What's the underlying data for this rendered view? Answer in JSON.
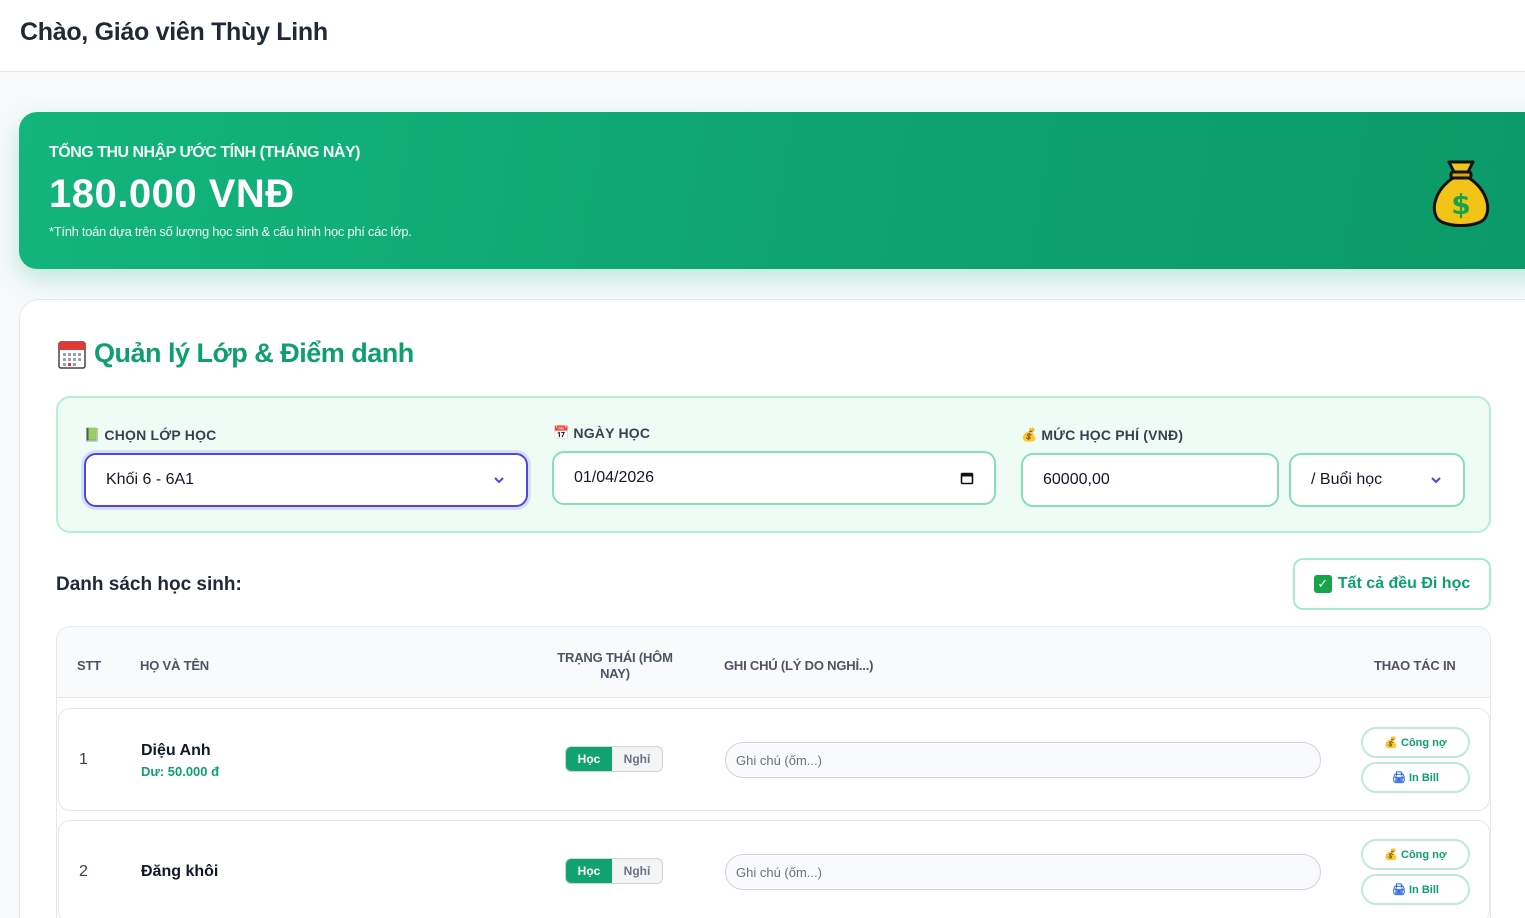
{
  "header": {
    "greeting": "Chào, Giáo viên Thùy Linh"
  },
  "income": {
    "label": "TỔNG THU NHẬP ƯỚC TÍNH (THÁNG NÀY)",
    "amount": "180.000 VNĐ",
    "note": "*Tính toán dựa trên số lượng học sinh & cấu hình học phí các lớp.",
    "icon": "money-bag-icon"
  },
  "section": {
    "title": "Quản lý Lớp & Điểm danh",
    "icon": "calendar-icon"
  },
  "filters": {
    "class_label": "CHỌN LỚP HỌC",
    "class_value": "Khối 6 - 6A1",
    "date_label": "NGÀY HỌC",
    "date_value": "01/04/2026",
    "fee_label": "MỨC HỌC PHÍ (VNĐ)",
    "fee_value": "60000,00",
    "unit_value": "/ Buổi học"
  },
  "list": {
    "title": "Danh sách học sinh:",
    "all_present_label": "Tất cả đều Đi học"
  },
  "table": {
    "columns": [
      "STT",
      "HỌ VÀ TÊN",
      "TRẠNG THÁI (HÔM NAY)",
      "GHI CHÚ (LÝ DO NGHỈ...)",
      "THAO TÁC IN"
    ],
    "rows": [
      {
        "stt": "1",
        "name": "Diệu Anh",
        "debt": "Dư: 50.000 đ",
        "present": "Học",
        "absent": "Nghỉ",
        "note_placeholder": "Ghi chú (ốm...)",
        "debt_btn": "Công nợ",
        "bill_btn": "In Bill"
      },
      {
        "stt": "2",
        "name": "Đăng khôi",
        "debt": "",
        "present": "Học",
        "absent": "Nghỉ",
        "note_placeholder": "Ghi chú (ốm...)",
        "debt_btn": "Công nợ",
        "bill_btn": "In Bill"
      }
    ]
  },
  "colors": {
    "primary_green": "#0e9f6e",
    "accent_indigo": "#4f46e5"
  }
}
